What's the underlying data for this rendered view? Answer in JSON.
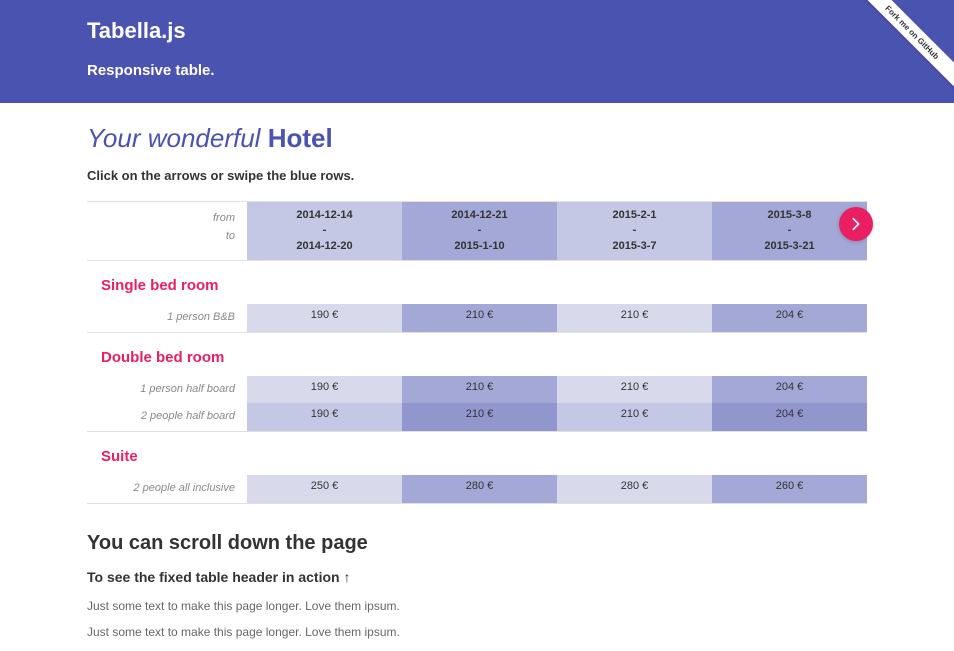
{
  "header": {
    "title": "Tabella.js",
    "subtitle": "Responsive table."
  },
  "github_ribbon": "Fork me on GitHub",
  "page_title": {
    "em": "Your wonderful",
    "strong": "Hotel"
  },
  "instruction": "Click on the arrows or swipe the blue rows.",
  "row_labels": {
    "from": "from",
    "to": "to"
  },
  "date_columns": [
    {
      "from": "2014-12-14",
      "to": "2014-12-20"
    },
    {
      "from": "2014-12-21",
      "to": "2015-1-10"
    },
    {
      "from": "2015-2-1",
      "to": "2015-3-7"
    },
    {
      "from": "2015-3-8",
      "to": "2015-3-21"
    }
  ],
  "sections": [
    {
      "title": "Single bed room",
      "rows": [
        {
          "label": "1 person B&B",
          "prices": [
            "190 €",
            "210 €",
            "210 €",
            "204 €"
          ]
        }
      ]
    },
    {
      "title": "Double bed room",
      "rows": [
        {
          "label": "1 person half board",
          "prices": [
            "190 €",
            "210 €",
            "210 €",
            "204 €"
          ]
        },
        {
          "label": "2 people half board",
          "prices": [
            "190 €",
            "210 €",
            "210 €",
            "204 €"
          ]
        }
      ]
    },
    {
      "title": "Suite",
      "rows": [
        {
          "label": "2 people all inclusive",
          "prices": [
            "250 €",
            "280 €",
            "280 €",
            "260 €"
          ]
        }
      ]
    }
  ],
  "footer": {
    "scroll_heading": "You can scroll down the page",
    "sub_heading": "To see the fixed table header in action ↑",
    "body_text1": "Just some text to make this page longer. Love them ipsum.",
    "body_text2": "Just some text to make this page longer. Love them ipsum."
  },
  "colors": {
    "brand": "#4b53b1",
    "accent": "#e91e63"
  }
}
